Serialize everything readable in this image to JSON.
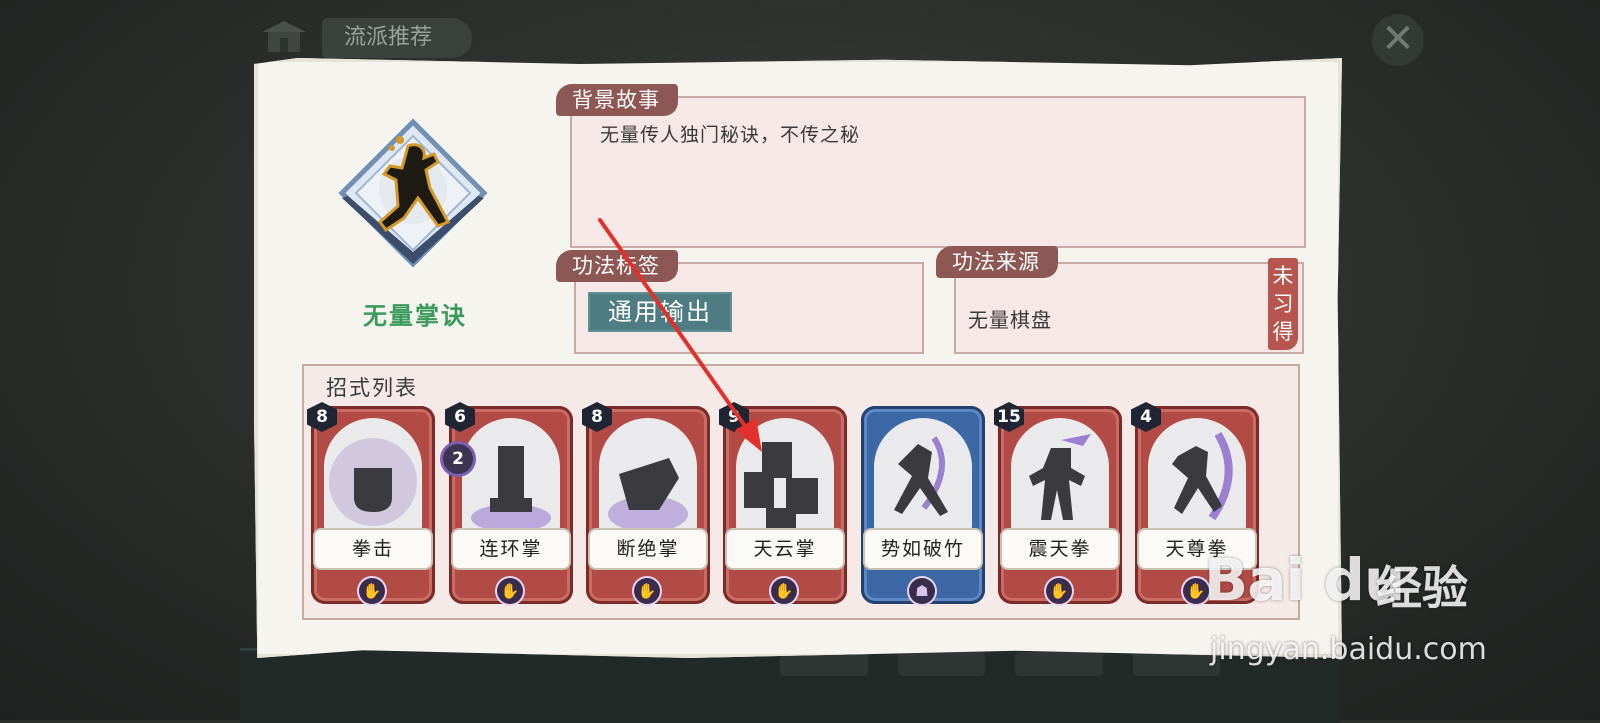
{
  "header": {
    "tab_label": "流派推荐",
    "close_glyph": "✕"
  },
  "technique": {
    "name": "无量掌诀",
    "story_label": "背景故事",
    "story_text": "无量传人独门秘诀，不传之秘",
    "tags_label": "功法标签",
    "tag": "通用输出",
    "source_label": "功法来源",
    "source": "无量棋盘",
    "status": "未习得"
  },
  "moves": {
    "title": "招式列表",
    "cards": [
      {
        "name": "拳击",
        "cost": "8",
        "variant": "red"
      },
      {
        "name": "连环掌",
        "cost": "6",
        "sub_cost": "2",
        "variant": "red"
      },
      {
        "name": "断绝掌",
        "cost": "8",
        "variant": "red"
      },
      {
        "name": "天云掌",
        "cost": "9",
        "variant": "red"
      },
      {
        "name": "势如破竹",
        "cost": "",
        "variant": "blue"
      },
      {
        "name": "震天拳",
        "cost": "15",
        "variant": "red"
      },
      {
        "name": "天尊拳",
        "cost": "4",
        "variant": "red"
      }
    ]
  },
  "watermark": {
    "brand": "Bai du",
    "sub": "经验",
    "url": "jingyan.baidu.com"
  },
  "colors": {
    "panel": "#f6f4ee",
    "label": "#8d5754",
    "tag": "#4d7d82",
    "name": "#3b9a5b",
    "card_red": "#b24b45",
    "card_blue": "#3d68a6",
    "arrow": "#e2302a"
  }
}
